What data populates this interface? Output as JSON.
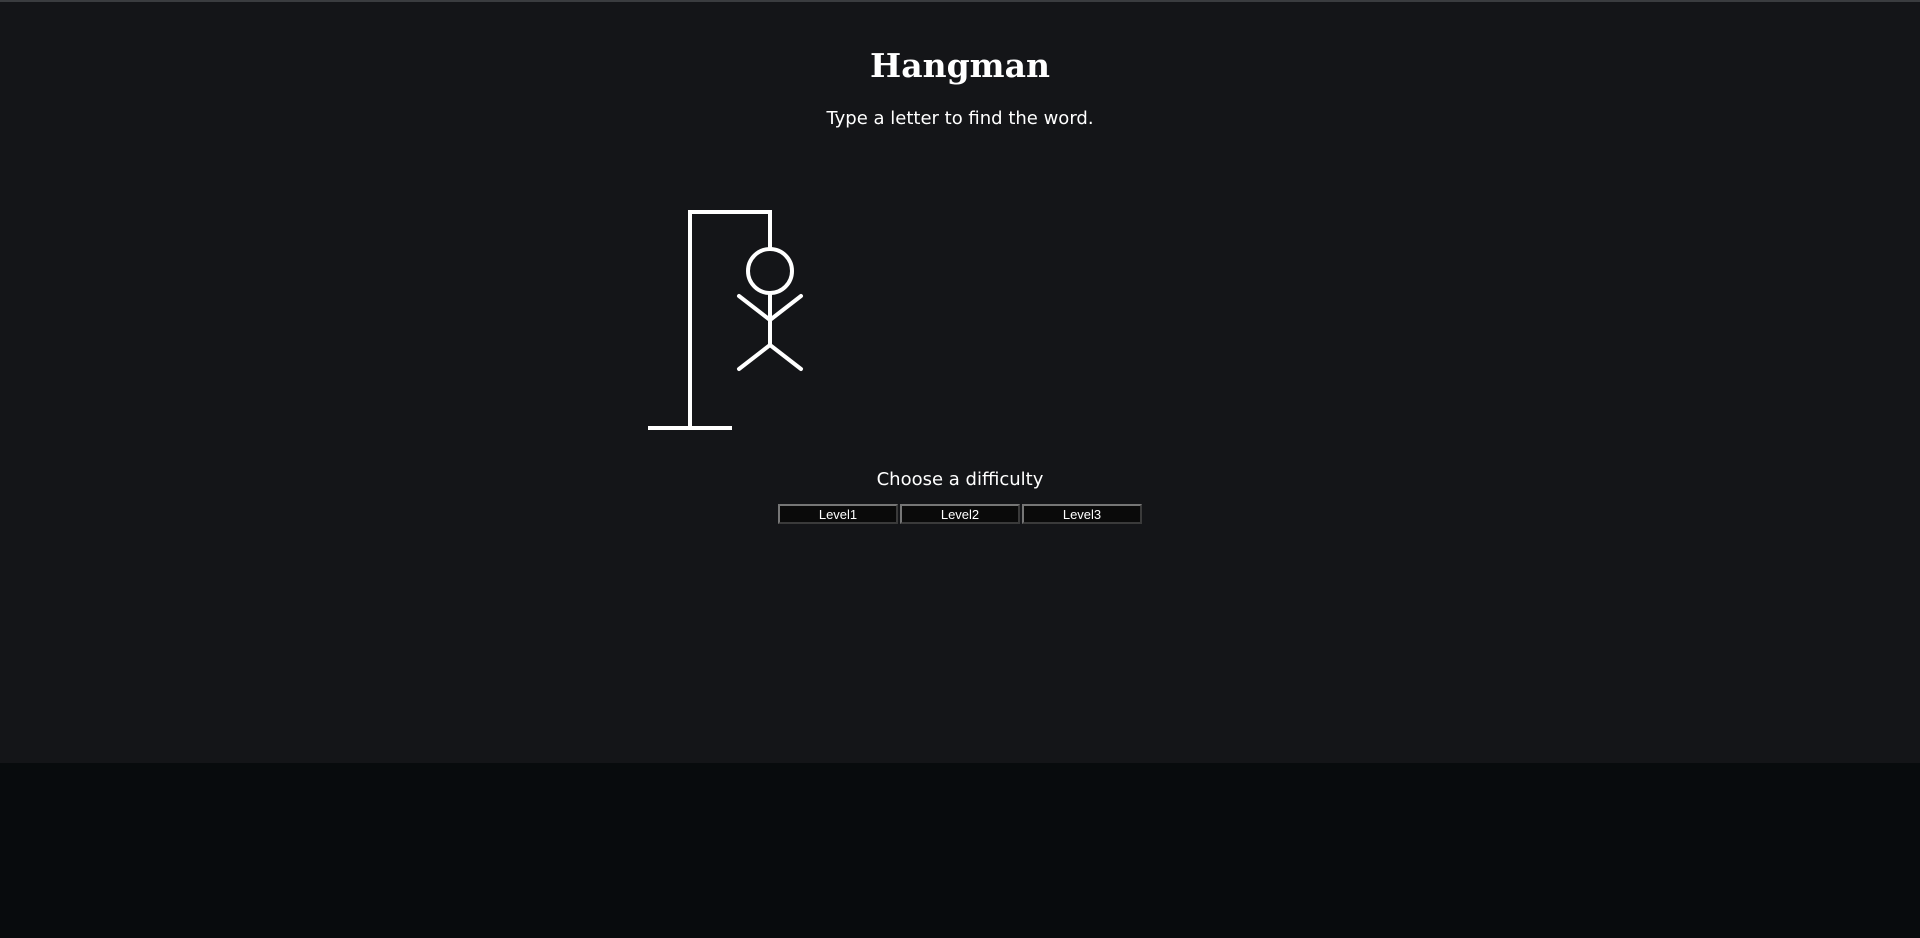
{
  "header": {
    "title": "Hangman",
    "subtitle": "Type a letter to find the word."
  },
  "figure": {
    "parts_visible": [
      "base",
      "pole",
      "beam",
      "rope",
      "head",
      "body",
      "left-arm",
      "right-arm",
      "left-leg",
      "right-leg"
    ],
    "stroke_color": "#ffffff"
  },
  "difficulty": {
    "title": "Choose a difficulty",
    "levels": [
      "Level1",
      "Level2",
      "Level3"
    ]
  },
  "colors": {
    "background": "#141518",
    "page_bottom": "#080b0d",
    "text": "#ffffff"
  }
}
